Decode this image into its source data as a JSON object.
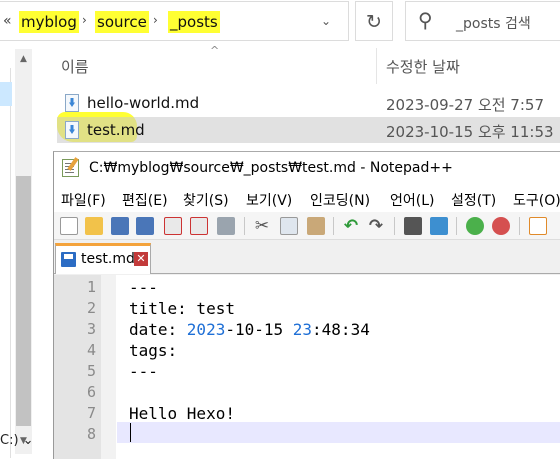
{
  "explorer": {
    "breadcrumb": {
      "lead": "«",
      "items": [
        "myblog",
        "source",
        "_posts"
      ]
    },
    "search_placeholder": "_posts 검색",
    "drive_label": "C:) ⌄",
    "columns": {
      "name": "이름",
      "date": "수정한 날짜"
    },
    "files": [
      {
        "name": "hello-world.md",
        "date": "2023-09-27 오전 7:57",
        "selected": false
      },
      {
        "name": "test.md",
        "date": "2023-10-15 오후 11:53",
        "selected": true
      }
    ]
  },
  "notepad": {
    "title": "C:₩myblog₩source₩_posts₩test.md - Notepad++",
    "menu": [
      "파일(F)",
      "편집(E)",
      "찾기(S)",
      "보기(V)",
      "인코딩(N)",
      "언어(L)",
      "설정(T)",
      "도구(O)"
    ],
    "tab": {
      "label": "test.md",
      "close": "✕"
    },
    "line_numbers": [
      "1",
      "2",
      "3",
      "4",
      "5",
      "6",
      "7",
      "8"
    ],
    "lines": [
      {
        "plain": "---"
      },
      {
        "plain": "title: test"
      },
      {
        "pre": "date: ",
        "n1": "2023",
        "mid": "-10-15 ",
        "n2": "23",
        "post": ":48:34"
      },
      {
        "plain": "tags:"
      },
      {
        "plain": "---"
      },
      {
        "plain": ""
      },
      {
        "plain": "Hello Hexo!"
      },
      {
        "plain": ""
      }
    ],
    "toolbar_icons": [
      "new-file-icon",
      "open-file-icon",
      "save-icon",
      "save-all-icon",
      "close-icon",
      "close-all-icon",
      "print-icon",
      "cut-icon",
      "copy-icon",
      "paste-icon",
      "undo-icon",
      "redo-icon",
      "find-icon",
      "replace-icon",
      "zoom-in-icon",
      "zoom-out-icon",
      "sync-scroll-icon"
    ]
  },
  "colors": {
    "highlight": "#ffff33",
    "number": "#1e6fd6",
    "tab_accent": "#f4a33c"
  }
}
